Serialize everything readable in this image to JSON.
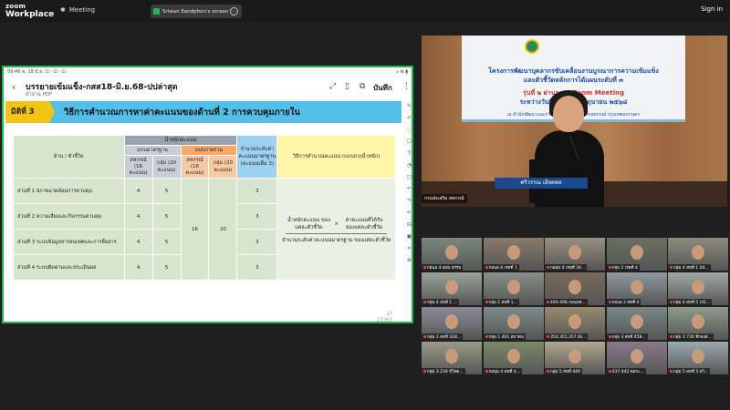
{
  "topbar": {
    "logo_line1": "zoom",
    "logo_line2": "Workplace",
    "meeting_label": "Meeting",
    "share_text": "Sriwan Eandphon's screen",
    "signin_label": "Sign in"
  },
  "shared": {
    "status_left": "09:46  พ. 18 มิ.ย. ⊡ ·  ⊡ ·  ⊡ ·",
    "status_right": "⁎ ⋒ ▮",
    "doc_title": "บรรยายเข้มแข็ง-กสส18-มิ.ย.68-ปปล่าสุด",
    "doc_sub": "ดำอ่าน PDF",
    "save_label": "บันทึก",
    "slide_tag": "มิติที่ 3",
    "slide_title": "วิธีการคำนวณการหาค่าคะแนนของด้านที่ 2 การควบคุมภายใน",
    "page_num": "27",
    "page_indicator": "27/63",
    "table": {
      "col_aspect": "ด้าน / ตัวชี้วัด",
      "col_weight": "น้ำหนักคะแนน",
      "col_standard": "แบบมาตรฐาน",
      "col_cluster": "แบบกลุ่ม",
      "col_standard_cluster": "แบบภาพรวม",
      "col_std_a": "สหกรณ์ (16 คะแนน)",
      "col_std_b": "กลุ่ม (20 คะแนน)",
      "col_all_a": "สหกรณ์ (16 คะแนน)",
      "col_all_b": "กลุ่ม (20 คะแนน)",
      "col_levels": "จำนวนระดับค่าคะแนนมาตรฐาน (คะแนนเต็ม 3)",
      "col_method": "วิธีการคำนวณคะแนน (แบบถ่วงน้ำหนัก)",
      "rows": [
        {
          "label": "ส่วนที่ 1 สภาพแวดล้อมการควบคุม",
          "a": "4",
          "b": "5",
          "lv": "3"
        },
        {
          "label": "ส่วนที่ 2 ความเสี่ยงและกิจกรรมควบคุม",
          "a": "4",
          "b": "5",
          "lv": "3"
        },
        {
          "label": "ส่วนที่ 3 ระบบข้อมูลสารสนเทศและการสื่อสาร",
          "a": "4",
          "b": "5",
          "lv": "3"
        },
        {
          "label": "ส่วนที่ 4 ระบบติดตามและประเมินผล",
          "a": "4",
          "b": "5",
          "lv": "3"
        }
      ],
      "total_a": "16",
      "total_b": "20",
      "formula_left": "น้ำหนักคะแนน ของแต่ละตัวชี้วัด",
      "formula_times": "×",
      "formula_right": "ค่าคะแนนที่ได้รับ ของแต่ละตัวชี้วัด",
      "formula_bottom": "จำนวนระดับค่าคะแนนมาตรฐาน ของแต่ละตัวชี้วัด"
    }
  },
  "speaker": {
    "board_line1": "โครงการพัฒนาบุคลากรขับเคลื่อนงานบูรณาการความเข้มแข็ง",
    "board_line2": "และตัวชี้วัดหลักการได้แผนระดับที่ ๓",
    "board_line3": "รุ่นที่ ๒ ผ่านระบบ Zoom Meeting",
    "board_line4": "ระหว่างวันที่ ๑๗ – ๑๙ มิถุนายน ๒๕๖๘",
    "board_line5": "ณ สำนักพัฒนาและถ่ายทอดเทคโนโลยีการสหกรณ์   กรุงเทพมหานคร",
    "name_plate": "ศรีวรรณ เอียดพล",
    "name_tag": "กรมส่งเสริม สหกรณ์"
  },
  "gallery": [
    {
      "label": "กอนอ 4 ตอบ ธรรม",
      "c": "#7a8a7c"
    },
    {
      "label": "กอนอ 4 เรตที่ 1",
      "c": "#8a7a6a"
    },
    {
      "label": "กอ่ลุ่ม 4 เรตที่ 34...",
      "c": "#9a9080"
    },
    {
      "label": "กลุ่ม 2 เรตที่ 4",
      "c": "#6a7060"
    },
    {
      "label": "กลุ่ม 4 สหที่ 1 04...",
      "c": "#8d8c7d"
    },
    {
      "label": "กลุ่ม 4 สหที่ 1 ...",
      "c": "#9aa49a"
    },
    {
      "label": "กลุ่ม 1 สหที่ 1...",
      "c": "#8a8f8a"
    },
    {
      "label": "495-496 กอนุกต...",
      "c": "#7a6a5a"
    },
    {
      "label": "กอนอ 2 สหที่ 4",
      "c": "#8e9aa0"
    },
    {
      "label": "กลุ่ม 4 สหที่ 5 (41...",
      "c": "#a0a8a4"
    },
    {
      "label": "กลุ่ม 1 สหที่ 428...",
      "c": "#8a8a9a"
    },
    {
      "label": "กลุ่ม 1 401 สมาคม",
      "c": "#7c8c8a"
    },
    {
      "label": "354,355,357 ยั่ง...",
      "c": "#9a8a70"
    },
    {
      "label": "กลุ่ม 3 สหที่ 458...",
      "c": "#788888"
    },
    {
      "label": "กลุ่ม 3 730 ที่กองส่...",
      "c": "#8c9c8a"
    },
    {
      "label": "กลุ่ม 3 234 จีโฟต...",
      "c": "#9a9a8a"
    },
    {
      "label": "กอนุ่ม 4 สหที่ 4...",
      "c": "#7a8a6a"
    },
    {
      "label": "กลุ่ม 5 สหที่ 449",
      "c": "#b0a890"
    },
    {
      "label": "437-442 ดอกะ...",
      "c": "#8a7a8a"
    },
    {
      "label": "กลุ่ม 5 สหที่ 3 สวิ...",
      "c": "#9aaab0"
    },
    {
      "label": "กลุ่ม 4 101-104",
      "c": "#8a8070"
    },
    {
      "label": "กลุ่ม 4 สหที่ 1",
      "c": "#7a7a6a"
    },
    {
      "label": "กลุ่ม 2 สหที่ 450",
      "c": "#8a9080"
    },
    {
      "label": "กลุ่ม 5 สหที่ 542",
      "c": "#9a8a8a"
    },
    {
      "label": "กลุ่ม 5 สหที่ 575 ...",
      "c": "#80909a"
    }
  ]
}
